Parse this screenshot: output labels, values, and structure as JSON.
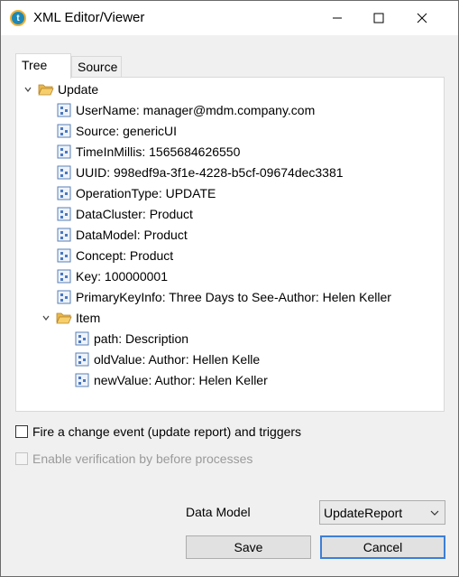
{
  "window": {
    "title": "XML Editor/Viewer"
  },
  "tabs": [
    {
      "label": "Tree"
    },
    {
      "label": "Source"
    }
  ],
  "tree": {
    "root": {
      "label": "Update",
      "children": [
        {
          "label": "UserName: manager@mdm.company.com"
        },
        {
          "label": "Source: genericUI"
        },
        {
          "label": "TimeInMillis: 1565684626550"
        },
        {
          "label": "UUID: 998edf9a-3f1e-4228-b5cf-09674dec3381"
        },
        {
          "label": "OperationType: UPDATE"
        },
        {
          "label": "DataCluster: Product"
        },
        {
          "label": "DataModel: Product"
        },
        {
          "label": "Concept: Product"
        },
        {
          "label": "Key: 100000001"
        },
        {
          "label": "PrimaryKeyInfo: Three Days to See-Author: Helen Keller"
        }
      ],
      "item": {
        "label": "Item",
        "children": [
          {
            "label": "path: Description"
          },
          {
            "label": "oldValue: Author: Hellen Kelle"
          },
          {
            "label": "newValue: Author: Helen Keller"
          }
        ]
      }
    }
  },
  "options": {
    "fire_change_event": {
      "label": "Fire a change event (update report) and triggers",
      "checked": false
    },
    "enable_verification": {
      "label": "Enable verification by before processes",
      "checked": false,
      "disabled": true
    }
  },
  "data_model": {
    "label": "Data Model",
    "selected": "UpdateReport"
  },
  "buttons": {
    "save": "Save",
    "cancel": "Cancel"
  }
}
